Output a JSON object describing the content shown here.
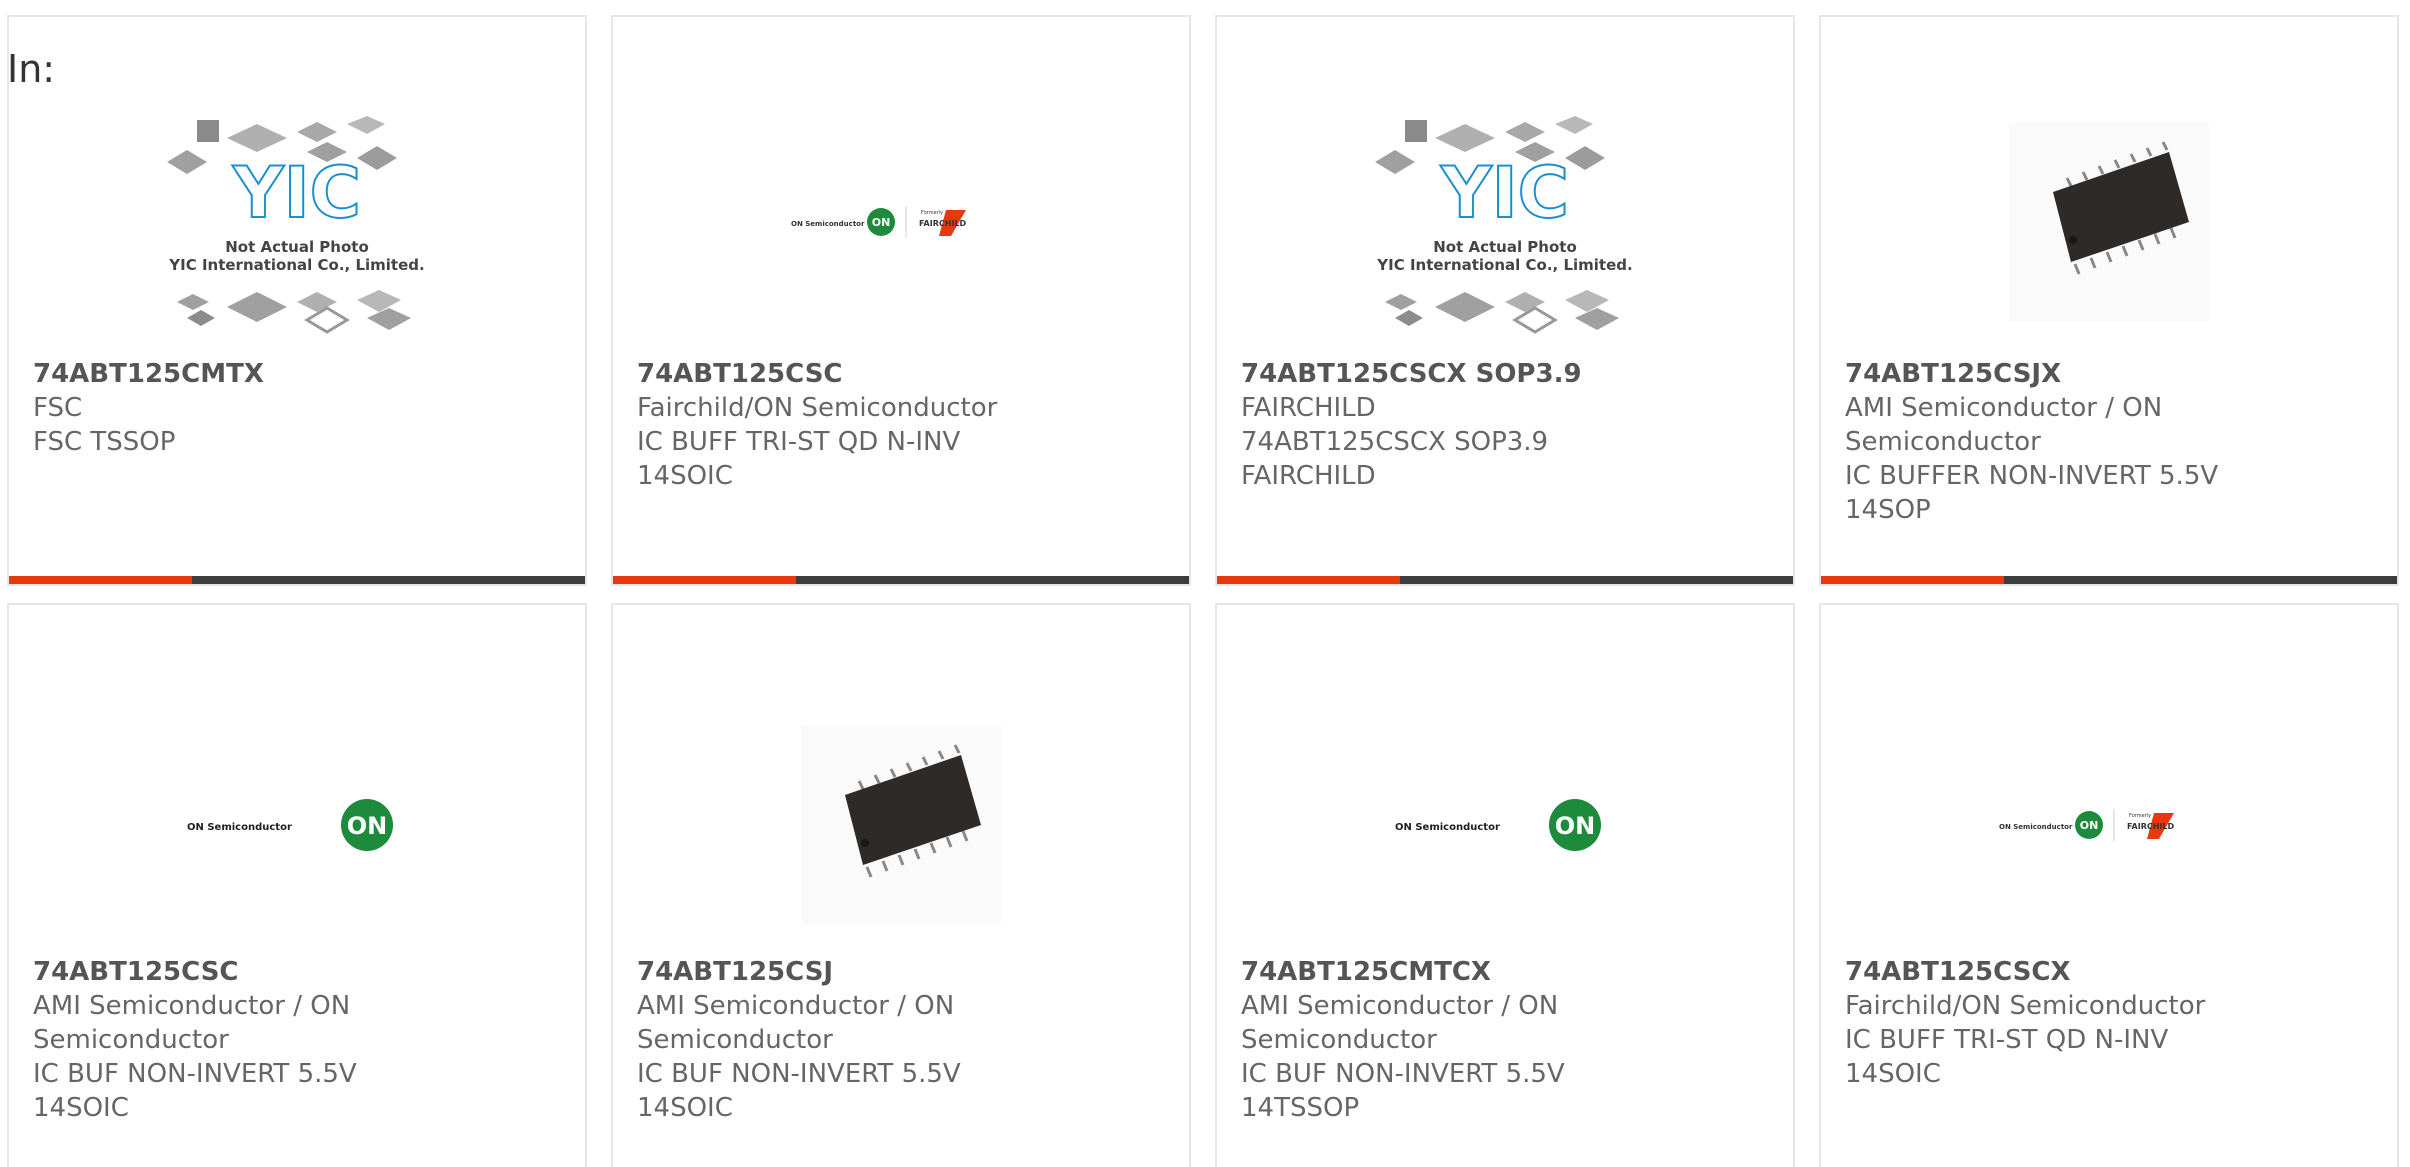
{
  "page": {
    "filter_label": "In:"
  },
  "products": [
    {
      "part": "74ABT125CMTX",
      "lines": [
        "FSC",
        "FSC TSSOP"
      ],
      "image": "yic-placeholder",
      "img_caption": [
        "Not Actual Photo",
        "YIC International Co., Limited."
      ],
      "logo_text": "YIC"
    },
    {
      "part": "74ABT125CSC",
      "lines": [
        "Fairchild/ON Semiconductor",
        "IC BUFF TRI-ST QD N-INV",
        "14SOIC"
      ],
      "image": "on-fairchild-logo",
      "logo_on": "ON Semiconductor",
      "logo_badge": "ON",
      "logo_formerly": "Formerly",
      "logo_fairchild": "FAIRCHILD"
    },
    {
      "part": "74ABT125CSCX SOP3.9",
      "lines": [
        "FAIRCHILD",
        "74ABT125CSCX SOP3.9",
        "FAIRCHILD"
      ],
      "image": "yic-placeholder",
      "img_caption": [
        "Not Actual Photo",
        "YIC International Co., Limited."
      ],
      "logo_text": "YIC"
    },
    {
      "part": "74ABT125CSJX",
      "lines": [
        "AMI Semiconductor / ON",
        "Semiconductor",
        "IC BUFFER NON-INVERT 5.5V",
        "14SOP"
      ],
      "image": "ic-chip"
    },
    {
      "part": "74ABT125CSC",
      "lines": [
        "AMI Semiconductor / ON",
        "Semiconductor",
        "IC BUF NON-INVERT 5.5V",
        "14SOIC"
      ],
      "image": "on-logo",
      "logo_on": "ON Semiconductor",
      "logo_badge": "ON"
    },
    {
      "part": "74ABT125CSJ",
      "lines": [
        "AMI Semiconductor / ON",
        "Semiconductor",
        "IC BUF NON-INVERT 5.5V",
        "14SOIC"
      ],
      "image": "ic-chip"
    },
    {
      "part": "74ABT125CMTCX",
      "lines": [
        "AMI Semiconductor / ON",
        "Semiconductor",
        "IC BUF NON-INVERT 5.5V",
        "14TSSOP"
      ],
      "image": "on-logo",
      "logo_on": "ON Semiconductor",
      "logo_badge": "ON"
    },
    {
      "part": "74ABT125CSCX",
      "lines": [
        "Fairchild/ON Semiconductor",
        "IC BUFF TRI-ST QD N-INV",
        "14SOIC"
      ],
      "image": "on-fairchild-logo",
      "logo_on": "ON Semiconductor",
      "logo_badge": "ON",
      "logo_formerly": "Formerly",
      "logo_fairchild": "FAIRCHILD"
    }
  ],
  "colors": {
    "accent": "#e8380d",
    "bar": "#3d3d3d",
    "on_green": "#1e8a3c",
    "chip": "#2e2a28"
  }
}
